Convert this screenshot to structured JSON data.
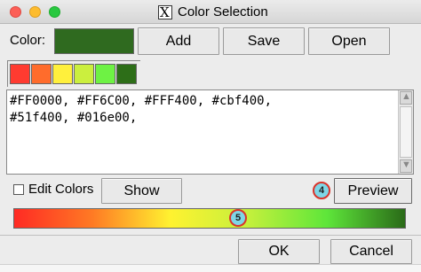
{
  "window": {
    "title": "Color Selection",
    "x_glyph": "X"
  },
  "color_row": {
    "label": "Color:",
    "current_color": "#2f6a1f",
    "add_label": "Add",
    "save_label": "Save",
    "open_label": "Open"
  },
  "palette": [
    "#FF3B30",
    "#FF6C2C",
    "#FFF03C",
    "#cbef3e",
    "#6ef244",
    "#2d6e18"
  ],
  "text": {
    "line1": "#FF0000, #FF6C00, #FFF400, #cbf400,",
    "line2": "#51f400, #016e00,"
  },
  "options": {
    "edit_colors_label": "Edit Colors",
    "edit_colors_checked": false,
    "show_label": "Show",
    "preview_label": "Preview"
  },
  "badges": {
    "preview_badge": "4",
    "gradient_badge": "5",
    "badge_color": "#7fd6e6",
    "badge_border": "#d9342b"
  },
  "gradient": {
    "stops": [
      "#ff2a24",
      "#ff7a24",
      "#fff230",
      "#c4f03c",
      "#5ee63a",
      "#2a6a18"
    ]
  },
  "footer": {
    "ok_label": "OK",
    "cancel_label": "Cancel"
  },
  "icons": {
    "scroll_up": "▲",
    "scroll_down": "▼"
  }
}
